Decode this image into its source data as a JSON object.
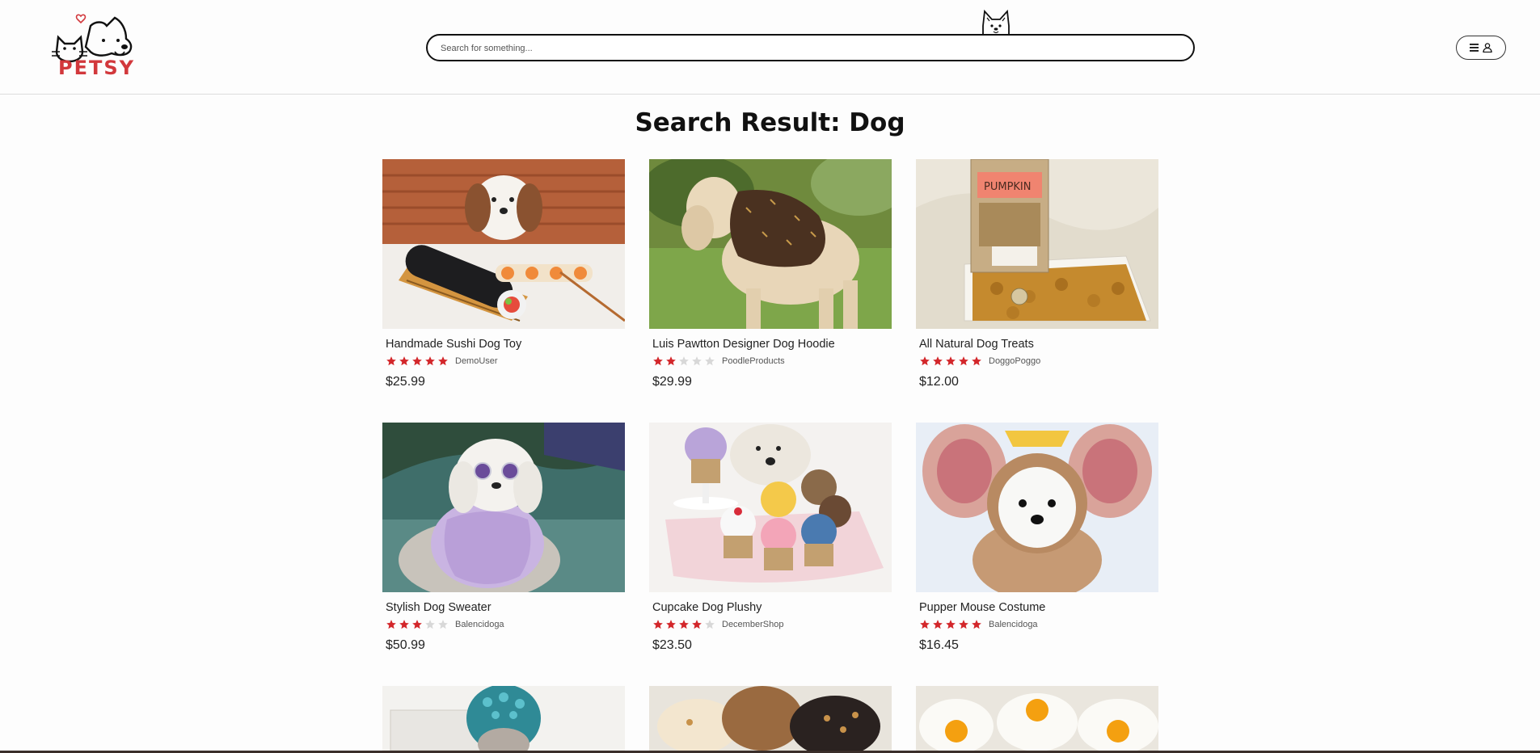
{
  "header": {
    "logo_text": "PETSY",
    "search_placeholder": "Search for something...",
    "menu_icon": "hamburger-icon",
    "user_icon": "user-icon"
  },
  "page": {
    "title": "Search Result: Dog"
  },
  "colors": {
    "brand": "#d2383c",
    "star_filled": "#d3272b",
    "star_empty": "#d8d8d8"
  },
  "products": [
    {
      "name": "Handmade Sushi Dog Toy",
      "rating": 5,
      "seller": "DemoUser",
      "price": "$25.99",
      "image": "sushi"
    },
    {
      "name": "Luis Pawtton Designer Dog Hoodie",
      "rating": 2,
      "seller": "PoodleProducts",
      "price": "$29.99",
      "image": "hoodie"
    },
    {
      "name": "All Natural Dog Treats",
      "rating": 5,
      "seller": "DoggoPoggo",
      "price": "$12.00",
      "image": "treats"
    },
    {
      "name": "Stylish Dog Sweater",
      "rating": 3,
      "seller": "Balencidoga",
      "price": "$50.99",
      "image": "sweater"
    },
    {
      "name": "Cupcake Dog Plushy",
      "rating": 4,
      "seller": "DecemberShop",
      "price": "$23.50",
      "image": "cupcake"
    },
    {
      "name": "Pupper Mouse Costume",
      "rating": 5,
      "seller": "Balencidoga",
      "price": "$16.45",
      "image": "mouse"
    },
    {
      "name": "",
      "rating": 0,
      "seller": "",
      "price": "",
      "image": "octopus"
    },
    {
      "name": "",
      "rating": 0,
      "seller": "",
      "price": "",
      "image": "cookies"
    },
    {
      "name": "",
      "rating": 0,
      "seller": "",
      "price": "",
      "image": "eggs"
    }
  ]
}
